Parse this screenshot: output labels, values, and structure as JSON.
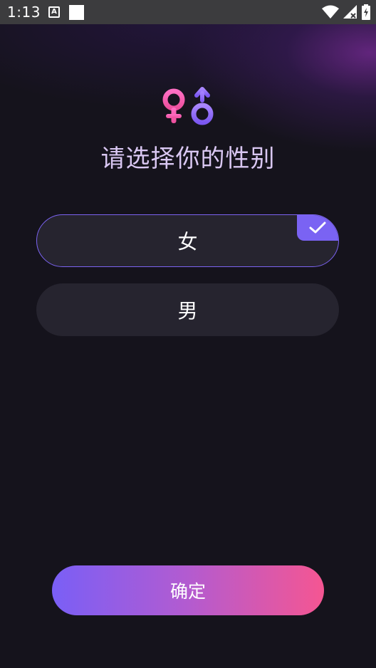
{
  "status_bar": {
    "time": "1:13",
    "notification_icon_letter": "A",
    "icons": [
      "wifi-icon",
      "signal-icon",
      "battery-icon"
    ]
  },
  "header": {
    "logo_icon": "gender-symbols-icon",
    "title": "请选择你的性别"
  },
  "options": [
    {
      "label": "女",
      "selected": true
    },
    {
      "label": "男",
      "selected": false
    }
  ],
  "confirm_button": {
    "label": "确定"
  },
  "colors": {
    "background": "#15131c",
    "option_bg": "#26242f",
    "accent": "#7a63f3",
    "title": "#d9c7f2",
    "gradient_start": "#7a5ff6",
    "gradient_end": "#f55692"
  }
}
